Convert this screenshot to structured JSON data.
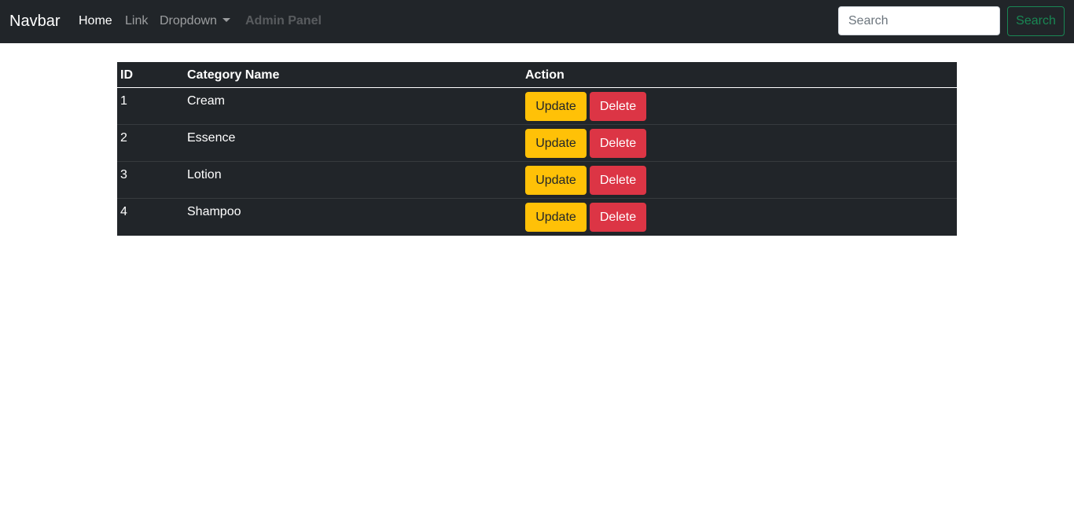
{
  "navbar": {
    "brand": "Navbar",
    "links": [
      {
        "label": "Home",
        "state": "active"
      },
      {
        "label": "Link",
        "state": "normal"
      },
      {
        "label": "Dropdown",
        "state": "dropdown"
      },
      {
        "label": "Admin Panel",
        "state": "disabled"
      }
    ],
    "search": {
      "placeholder": "Search",
      "value": "",
      "button_label": "Search"
    }
  },
  "table": {
    "columns": [
      "ID",
      "Category Name",
      "Action"
    ],
    "rows": [
      {
        "id": "1",
        "name": "Cream"
      },
      {
        "id": "2",
        "name": "Essence"
      },
      {
        "id": "3",
        "name": "Lotion"
      },
      {
        "id": "4",
        "name": "Shampoo"
      }
    ],
    "update_label": "Update",
    "delete_label": "Delete"
  },
  "colors": {
    "navbar_bg": "#212529",
    "table_bg": "#212529",
    "update_button": "#ffc107",
    "delete_button": "#dc3545",
    "search_button": "#198754"
  },
  "icons": {
    "dropdown": "caret-down-icon"
  }
}
